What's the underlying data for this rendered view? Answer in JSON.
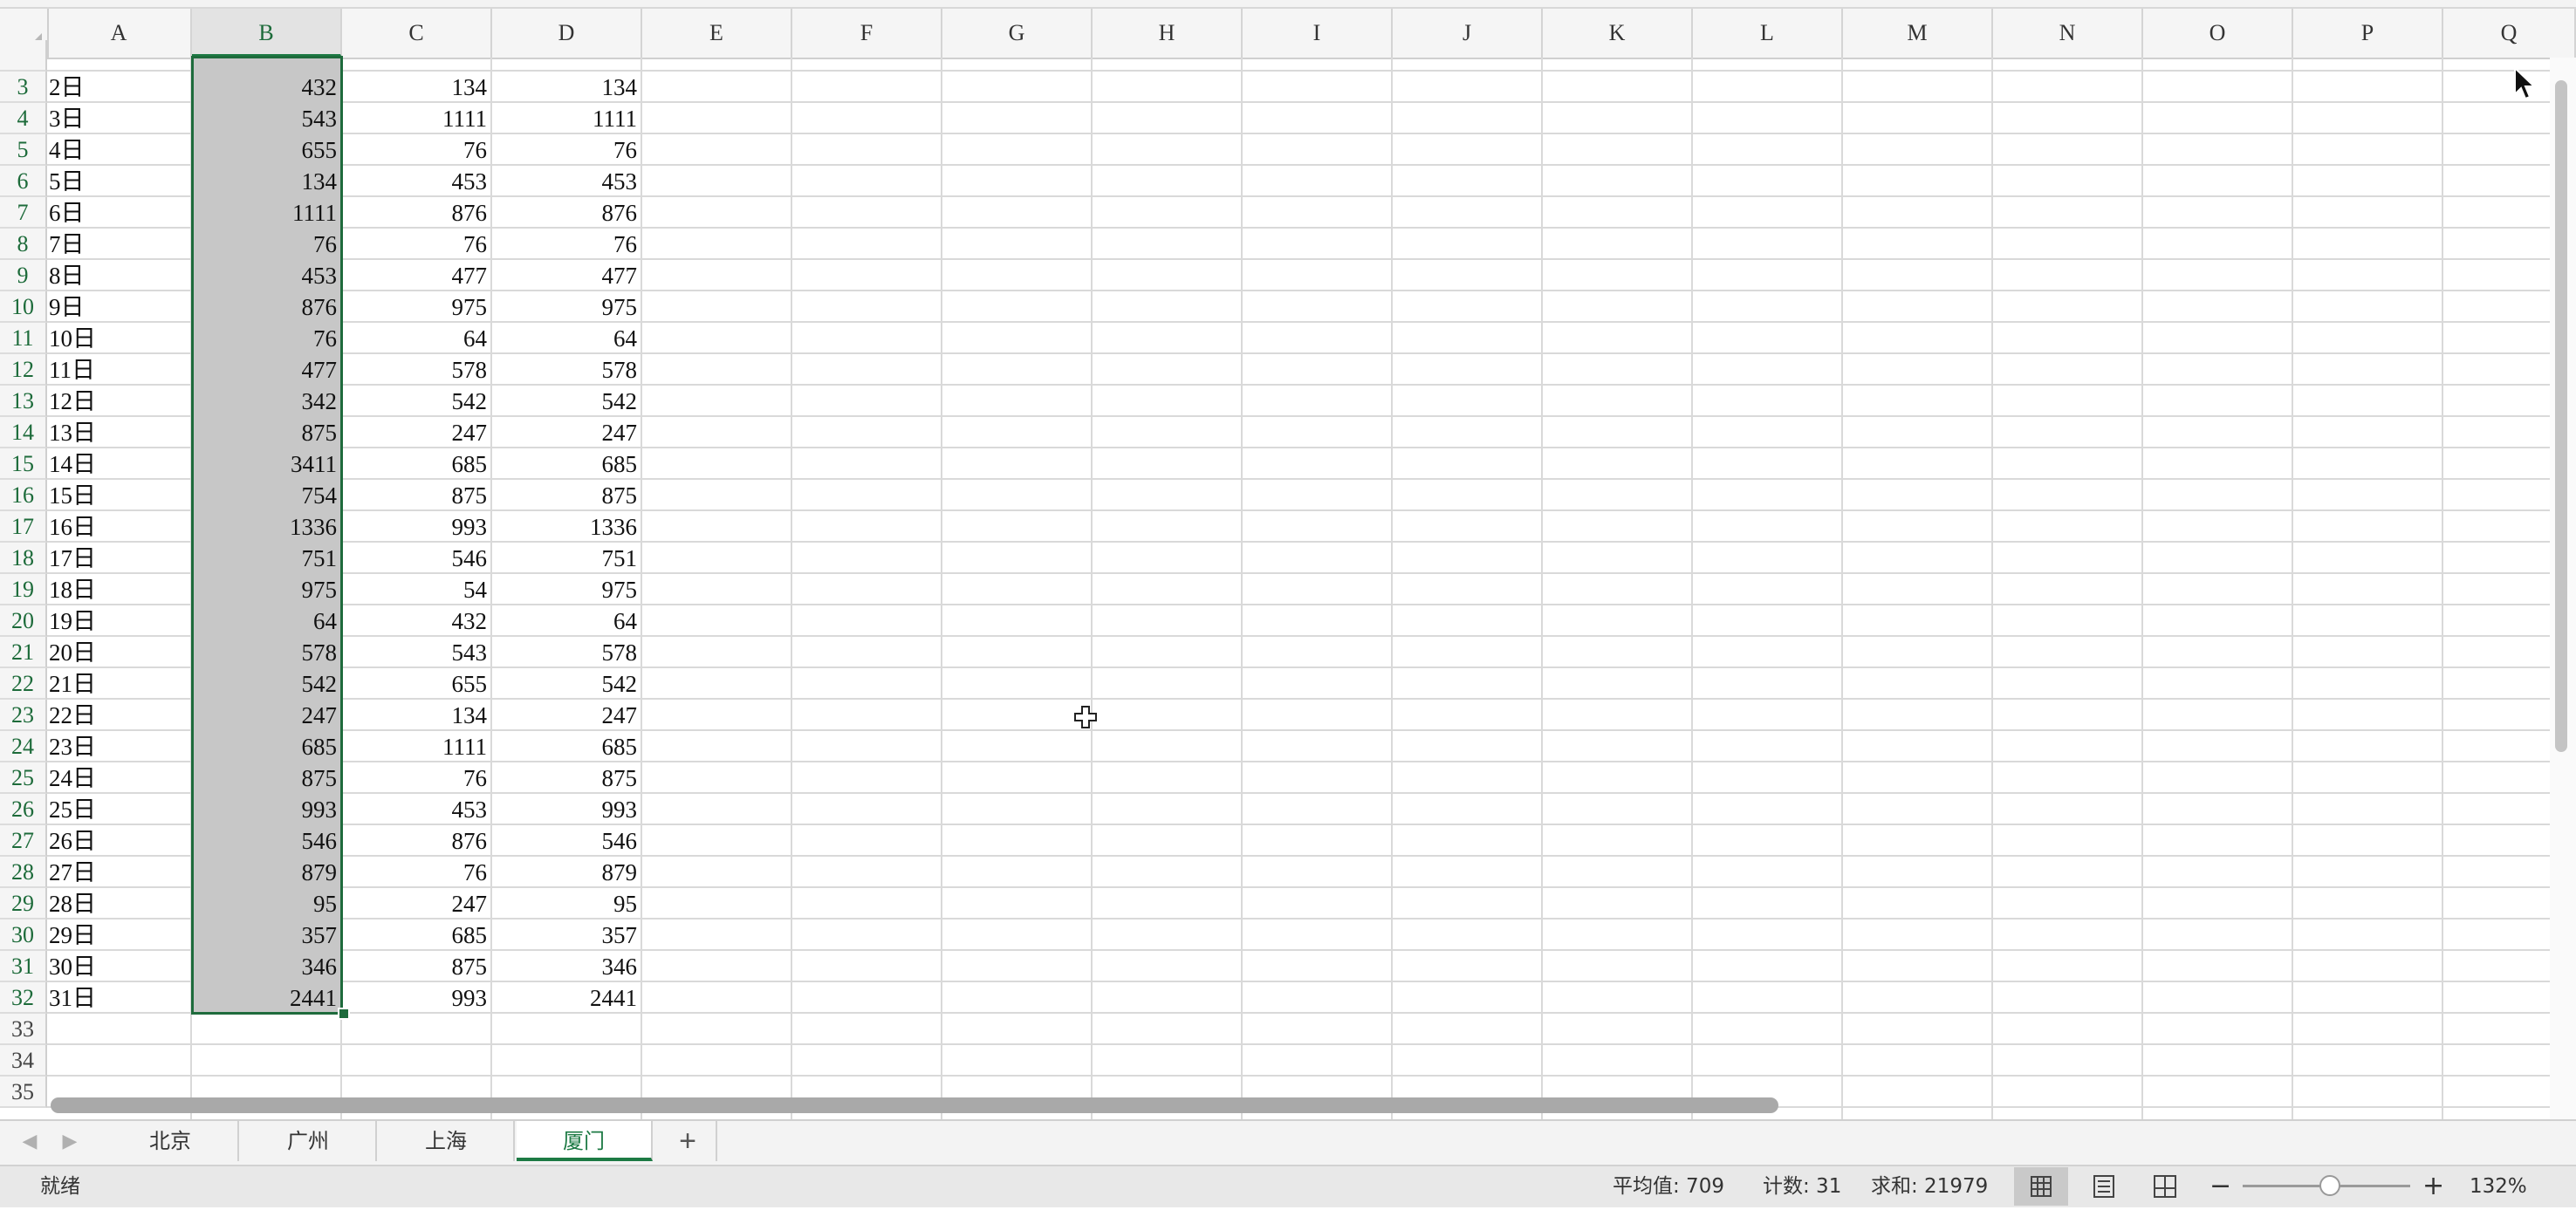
{
  "columns": [
    "A",
    "B",
    "C",
    "D",
    "E",
    "F",
    "G",
    "H",
    "I",
    "J",
    "K",
    "L",
    "M",
    "N",
    "O",
    "P",
    "Q"
  ],
  "selected_column": "B",
  "row_numbers": [
    "3",
    "4",
    "5",
    "6",
    "7",
    "8",
    "9",
    "10",
    "11",
    "12",
    "13",
    "14",
    "15",
    "16",
    "17",
    "18",
    "19",
    "20",
    "21",
    "22",
    "23",
    "24",
    "25",
    "26",
    "27",
    "28",
    "29",
    "30",
    "31",
    "32",
    "33",
    "34",
    "35"
  ],
  "rows": [
    {
      "a": "2日",
      "b": "432",
      "c": "134",
      "d": "134"
    },
    {
      "a": "3日",
      "b": "543",
      "c": "1111",
      "d": "1111"
    },
    {
      "a": "4日",
      "b": "655",
      "c": "76",
      "d": "76"
    },
    {
      "a": "5日",
      "b": "134",
      "c": "453",
      "d": "453"
    },
    {
      "a": "6日",
      "b": "1111",
      "c": "876",
      "d": "876"
    },
    {
      "a": "7日",
      "b": "76",
      "c": "76",
      "d": "76"
    },
    {
      "a": "8日",
      "b": "453",
      "c": "477",
      "d": "477"
    },
    {
      "a": "9日",
      "b": "876",
      "c": "975",
      "d": "975"
    },
    {
      "a": "10日",
      "b": "76",
      "c": "64",
      "d": "64"
    },
    {
      "a": "11日",
      "b": "477",
      "c": "578",
      "d": "578"
    },
    {
      "a": "12日",
      "b": "342",
      "c": "542",
      "d": "542"
    },
    {
      "a": "13日",
      "b": "875",
      "c": "247",
      "d": "247"
    },
    {
      "a": "14日",
      "b": "3411",
      "c": "685",
      "d": "685"
    },
    {
      "a": "15日",
      "b": "754",
      "c": "875",
      "d": "875"
    },
    {
      "a": "16日",
      "b": "1336",
      "c": "993",
      "d": "1336"
    },
    {
      "a": "17日",
      "b": "751",
      "c": "546",
      "d": "751"
    },
    {
      "a": "18日",
      "b": "975",
      "c": "54",
      "d": "975"
    },
    {
      "a": "19日",
      "b": "64",
      "c": "432",
      "d": "64"
    },
    {
      "a": "20日",
      "b": "578",
      "c": "543",
      "d": "578"
    },
    {
      "a": "21日",
      "b": "542",
      "c": "655",
      "d": "542"
    },
    {
      "a": "22日",
      "b": "247",
      "c": "134",
      "d": "247"
    },
    {
      "a": "23日",
      "b": "685",
      "c": "1111",
      "d": "685"
    },
    {
      "a": "24日",
      "b": "875",
      "c": "76",
      "d": "875"
    },
    {
      "a": "25日",
      "b": "993",
      "c": "453",
      "d": "993"
    },
    {
      "a": "26日",
      "b": "546",
      "c": "876",
      "d": "546"
    },
    {
      "a": "27日",
      "b": "879",
      "c": "76",
      "d": "879"
    },
    {
      "a": "28日",
      "b": "95",
      "c": "247",
      "d": "95"
    },
    {
      "a": "29日",
      "b": "357",
      "c": "685",
      "d": "357"
    },
    {
      "a": "30日",
      "b": "346",
      "c": "875",
      "d": "346"
    },
    {
      "a": "31日",
      "b": "2441",
      "c": "993",
      "d": "2441"
    }
  ],
  "sheet_tabs": [
    {
      "label": "北京",
      "active": false
    },
    {
      "label": "广州",
      "active": false
    },
    {
      "label": "上海",
      "active": false
    },
    {
      "label": "厦门",
      "active": true
    }
  ],
  "add_sheet_label": "+",
  "status": {
    "ready": "就绪",
    "average": "平均值: 709",
    "count": "计数: 31",
    "sum": "求和: 21979",
    "zoom": "132%"
  },
  "colors": {
    "selection_border": "#1e6b3c",
    "selection_fill": "#c7c7c7",
    "active_tab_text": "#1d7a44"
  },
  "icons": {
    "tab_prev": "triangle-left-icon",
    "tab_next": "triangle-right-icon",
    "view_normal": "grid-icon",
    "view_page_layout": "page-icon",
    "view_page_break": "page-break-icon",
    "zoom_out": "minus-icon",
    "zoom_in": "plus-icon"
  }
}
